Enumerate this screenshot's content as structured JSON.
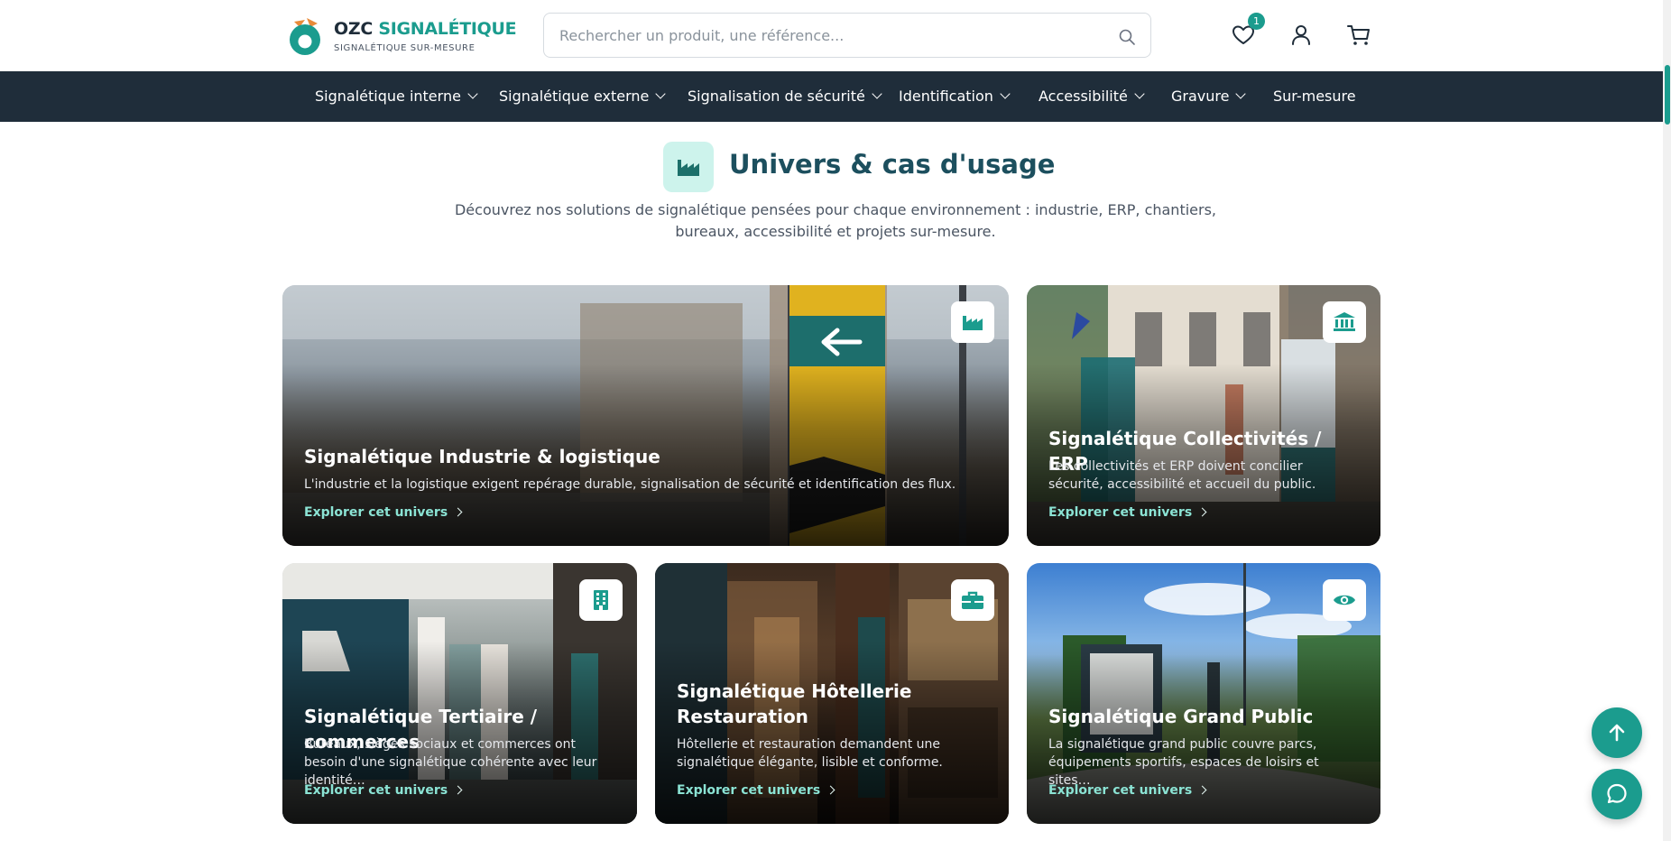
{
  "brand": {
    "name_part1": "OZC",
    "name_part2": "SIGNALÉTIQUE",
    "tagline": "SIGNALÉTIQUE SUR-MESURE"
  },
  "search": {
    "placeholder": "Rechercher un produit, une référence...",
    "value": ""
  },
  "header": {
    "wishlist_count": "1",
    "icons": [
      "heart-icon",
      "user-icon",
      "cart-icon"
    ]
  },
  "nav": {
    "items": [
      {
        "label": "Signalétique interne",
        "dropdown": true
      },
      {
        "label": "Signalétique externe",
        "dropdown": true
      },
      {
        "label": "Signalisation de sécurité",
        "dropdown": true
      },
      {
        "label": "Identification",
        "dropdown": true
      },
      {
        "label": "Accessibilité",
        "dropdown": true
      },
      {
        "label": "Gravure",
        "dropdown": true
      },
      {
        "label": "Sur-mesure",
        "dropdown": false
      }
    ]
  },
  "section": {
    "title": "Univers & cas d'usage",
    "description": "Découvrez nos solutions de signalétique pensées pour chaque environnement : industrie, ERP, chantiers, bureaux, accessibilité et projets sur-mesure."
  },
  "cards": [
    {
      "title": "Signalétique Industrie & logistique",
      "description": "L'industrie et la logistique exigent repérage durable, signalisation de sécurité et identification des flux.",
      "link": "Explorer cet univers",
      "icon": "factory-icon"
    },
    {
      "title": "Signalétique Collectivités / ERP",
      "description": "Les collectivités et ERP doivent concilier sécurité, accessibilité et accueil du public.",
      "link": "Explorer cet univers",
      "icon": "landmark-icon"
    },
    {
      "title": "Signalétique Tertiaire / commerces",
      "description": "Bureaux, sièges sociaux et commerces ont besoin d'une signalétique cohérente avec leur identité…",
      "link": "Explorer cet univers",
      "icon": "office-building-icon"
    },
    {
      "title": "Signalétique Hôtellerie Restauration",
      "description": "Hôtellerie et restauration demandent une signalétique élégante, lisible et conforme.",
      "link": "Explorer cet univers",
      "icon": "briefcase-icon"
    },
    {
      "title": "Signalétique Grand Public",
      "description": "La signalétique grand public couvre parcs, équipements sportifs, espaces de loisirs et sites…",
      "link": "Explorer cet univers",
      "icon": "eye-icon"
    }
  ],
  "colors": {
    "accent": "#1b9c8e",
    "nav_bg": "#1f2d3a",
    "title": "#1c4f5e",
    "link": "#8be3d4"
  },
  "floating": {
    "icons": [
      "arrow-up-icon",
      "chat-icon"
    ]
  }
}
